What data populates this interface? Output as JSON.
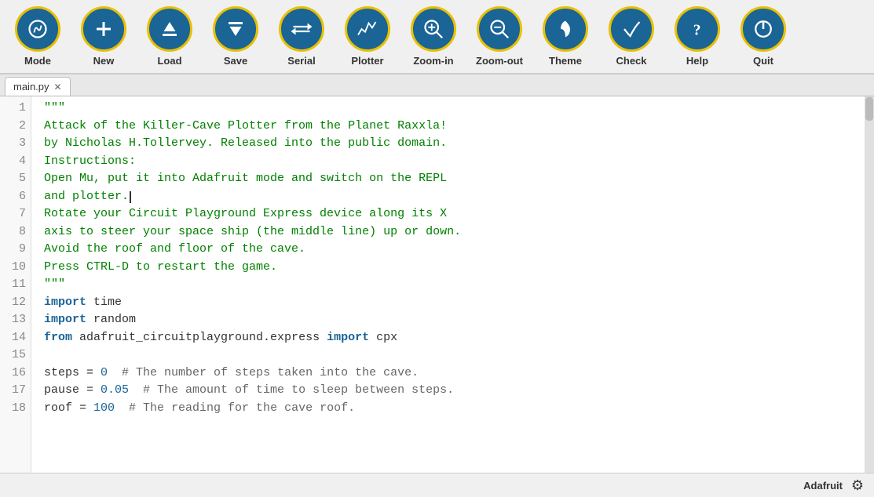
{
  "toolbar": {
    "buttons": [
      {
        "id": "mode",
        "label": "Mode",
        "icon": "mode"
      },
      {
        "id": "new",
        "label": "New",
        "icon": "new"
      },
      {
        "id": "load",
        "label": "Load",
        "icon": "load"
      },
      {
        "id": "save",
        "label": "Save",
        "icon": "save"
      },
      {
        "id": "serial",
        "label": "Serial",
        "icon": "serial"
      },
      {
        "id": "plotter",
        "label": "Plotter",
        "icon": "plotter"
      },
      {
        "id": "zoom-in",
        "label": "Zoom-in",
        "icon": "zoom-in"
      },
      {
        "id": "zoom-out",
        "label": "Zoom-out",
        "icon": "zoom-out"
      },
      {
        "id": "theme",
        "label": "Theme",
        "icon": "theme"
      },
      {
        "id": "check",
        "label": "Check",
        "icon": "check"
      },
      {
        "id": "help",
        "label": "Help",
        "icon": "help"
      },
      {
        "id": "quit",
        "label": "Quit",
        "icon": "quit"
      }
    ]
  },
  "tab": {
    "filename": "main.py"
  },
  "code": {
    "lines": [
      {
        "n": 1,
        "tokens": [
          {
            "t": "string",
            "v": "\"\"\""
          }
        ]
      },
      {
        "n": 2,
        "tokens": [
          {
            "t": "string",
            "v": "Attack of the Killer-Cave Plotter from the Planet Raxxla!"
          }
        ]
      },
      {
        "n": 3,
        "tokens": [
          {
            "t": "string",
            "v": "by Nicholas H.Tollervey. Released into the public domain."
          }
        ]
      },
      {
        "n": 4,
        "tokens": [
          {
            "t": "string",
            "v": "Instructions:"
          }
        ]
      },
      {
        "n": 5,
        "tokens": [
          {
            "t": "string",
            "v": "Open Mu, put it into Adafruit mode and switch on the REPL"
          }
        ]
      },
      {
        "n": 6,
        "tokens": [
          {
            "t": "string",
            "v": "and plotter."
          }
        ]
      },
      {
        "n": 7,
        "tokens": [
          {
            "t": "string",
            "v": "Rotate your Circuit Playground Express device along its X"
          }
        ]
      },
      {
        "n": 8,
        "tokens": [
          {
            "t": "string",
            "v": "axis to steer your space ship (the middle line) up or down."
          }
        ]
      },
      {
        "n": 9,
        "tokens": [
          {
            "t": "string",
            "v": "Avoid the roof and floor of the cave."
          }
        ]
      },
      {
        "n": 10,
        "tokens": [
          {
            "t": "string",
            "v": "Press CTRL-D to restart the game."
          }
        ]
      },
      {
        "n": 11,
        "tokens": [
          {
            "t": "string",
            "v": "\"\"\""
          }
        ]
      },
      {
        "n": 12,
        "tokens": [
          {
            "t": "keyword",
            "v": "import"
          },
          {
            "t": "default",
            "v": " time"
          }
        ]
      },
      {
        "n": 13,
        "tokens": [
          {
            "t": "keyword",
            "v": "import"
          },
          {
            "t": "default",
            "v": " random"
          }
        ]
      },
      {
        "n": 14,
        "tokens": [
          {
            "t": "keyword",
            "v": "from"
          },
          {
            "t": "default",
            "v": " adafruit_circuitplayground.express "
          },
          {
            "t": "keyword",
            "v": "import"
          },
          {
            "t": "default",
            "v": " cpx"
          }
        ]
      },
      {
        "n": 15,
        "tokens": [
          {
            "t": "default",
            "v": ""
          }
        ]
      },
      {
        "n": 16,
        "tokens": [
          {
            "t": "default",
            "v": "steps = "
          },
          {
            "t": "number",
            "v": "0"
          },
          {
            "t": "comment",
            "v": "  # The number of steps taken into the cave."
          }
        ]
      },
      {
        "n": 17,
        "tokens": [
          {
            "t": "default",
            "v": "pause = "
          },
          {
            "t": "number",
            "v": "0.05"
          },
          {
            "t": "comment",
            "v": "  # The amount of time to sleep between steps."
          }
        ]
      },
      {
        "n": 18,
        "tokens": [
          {
            "t": "default",
            "v": "roof = "
          },
          {
            "t": "number",
            "v": "100"
          },
          {
            "t": "comment",
            "v": "  # The reading for the cave roof."
          }
        ]
      }
    ]
  },
  "statusbar": {
    "label": "Adafruit",
    "gear_title": "Settings"
  }
}
